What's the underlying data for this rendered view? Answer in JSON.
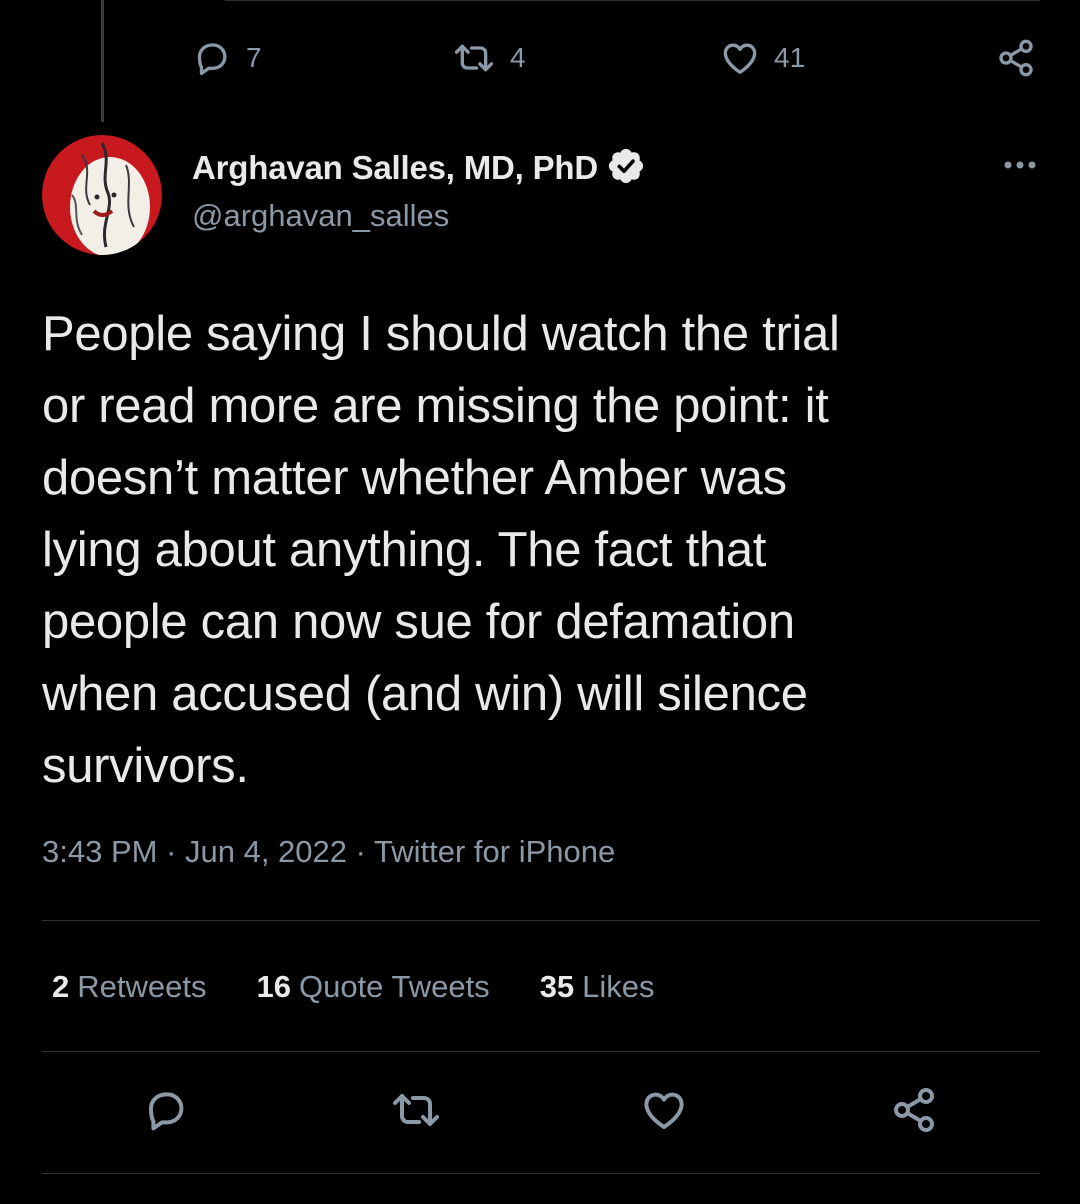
{
  "previous_tweet": {
    "actions": {
      "reply_count": "7",
      "retweet_count": "4",
      "like_count": "41"
    }
  },
  "tweet": {
    "author": {
      "name": "Arghavan Salles, MD, PhD",
      "handle": "@arghavan_salles",
      "verified": true
    },
    "text": "People saying I should watch the trial\nor read more are missing the point: it\ndoesn’t matter whether Amber was\nlying about anything. The fact that\npeople can now sue for defamation\nwhen accused (and win) will silence\nsurvivors.",
    "meta": "3:43 PM · Jun 4, 2022 · Twitter for iPhone",
    "stats": {
      "retweets_count": "2",
      "retweets_label": "Retweets",
      "quote_tweets_count": "16",
      "quote_tweets_label": "Quote Tweets",
      "likes_count": "35",
      "likes_label": "Likes"
    }
  },
  "icons": {
    "reply": "reply-icon",
    "retweet": "retweet-icon",
    "like": "heart-icon",
    "share": "share-icon",
    "more": "more-icon",
    "verified": "verified-badge-icon"
  },
  "colors": {
    "background": "#000000",
    "text_primary": "#e7e9ea",
    "text_secondary": "#8b98a5",
    "divider": "#2f3336",
    "avatar_accent": "#c8191e"
  }
}
